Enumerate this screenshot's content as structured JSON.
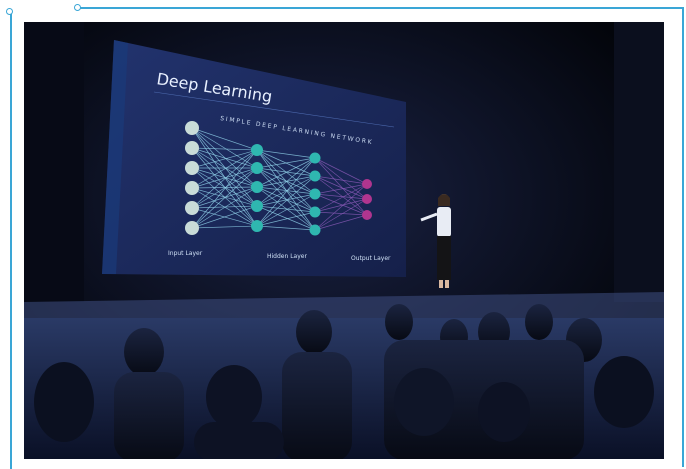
{
  "slide": {
    "title": "Deep Learning",
    "subtitle": "SIMPLE DEEP LEARNING NETWORK",
    "layers": {
      "input": "Input Layer",
      "hidden": "Hidden Layer",
      "output": "Output Layer"
    }
  },
  "colors": {
    "frame_accent": "#3aa6d6",
    "screen_bg": "#1d2a5c",
    "input_node": "#c9dcd8",
    "hidden_node": "#2fb7b0",
    "output_node": "#b0358f"
  }
}
